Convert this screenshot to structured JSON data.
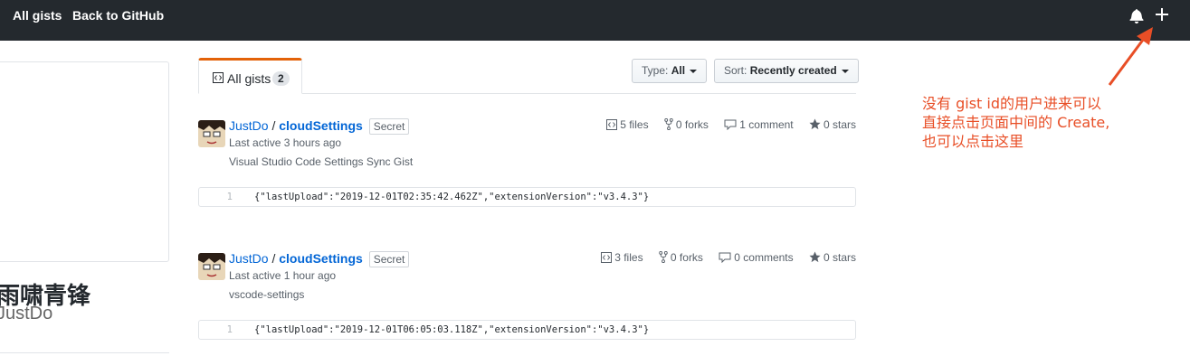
{
  "header": {
    "nav": [
      "All gists",
      "Back to GitHub"
    ]
  },
  "profile": {
    "name": "雨啸青锋",
    "login": "JustDo"
  },
  "tabs": {
    "all_gists": {
      "label": "All gists",
      "count": "2"
    }
  },
  "filters": {
    "type": {
      "label": "Type:",
      "value": "All"
    },
    "sort": {
      "label": "Sort:",
      "value": "Recently created"
    }
  },
  "gists": [
    {
      "owner": "JustDo",
      "file": "cloudSettings",
      "badge": "Secret",
      "active": "Last active 3 hours ago",
      "description": "Visual Studio Code Settings Sync Gist",
      "stats": {
        "files": "5 files",
        "forks": "0 forks",
        "comments": "1 comment",
        "stars": "0 stars"
      },
      "line_number": "1",
      "code": "{\"lastUpload\":\"2019-12-01T02:35:42.462Z\",\"extensionVersion\":\"v3.4.3\"}"
    },
    {
      "owner": "JustDo",
      "file": "cloudSettings",
      "badge": "Secret",
      "active": "Last active 1 hour ago",
      "description": "vscode-settings",
      "stats": {
        "files": "3 files",
        "forks": "0 forks",
        "comments": "0 comments",
        "stars": "0 stars"
      },
      "line_number": "1",
      "code": "{\"lastUpload\":\"2019-12-01T06:05:03.118Z\",\"extensionVersion\":\"v3.4.3\"}"
    }
  ],
  "annotation": {
    "lines": [
      "没有 gist id的用户进来可以",
      "直接点击页面中间的  Create,",
      "也可以点击这里"
    ],
    "color": "#e84e26"
  },
  "colors": {
    "header_bg": "#24292e",
    "tab_accent": "#e36209",
    "link": "#0366d6"
  },
  "icons": [
    "bell-icon",
    "plus-icon",
    "code-icon",
    "fork-icon",
    "comment-icon",
    "star-icon"
  ]
}
